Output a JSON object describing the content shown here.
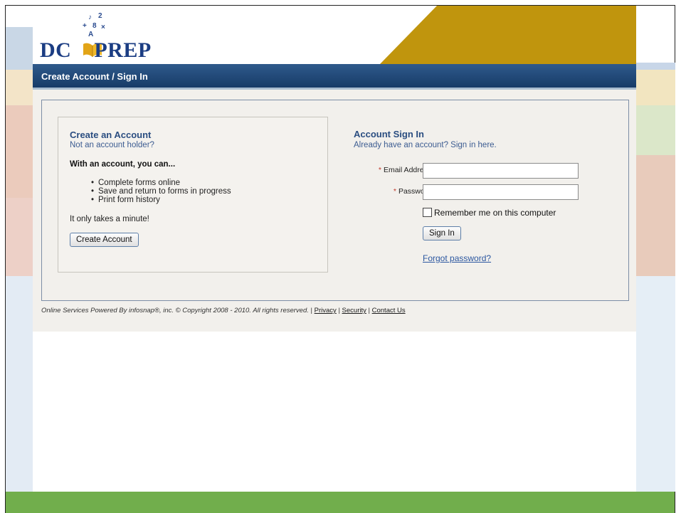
{
  "header": {
    "logo_text_left": "DC",
    "logo_text_right": "PREP",
    "logo_glyphs": [
      "♪",
      "2",
      "8",
      "A",
      "+",
      "×"
    ]
  },
  "titlebar": {
    "title": "Create Account / Sign In"
  },
  "create_account": {
    "heading": "Create an Account",
    "subheading": "Not an account holder?",
    "lead": "With an account, you can...",
    "benefits": [
      "Complete forms online",
      "Save and return to forms in progress",
      "Print form history"
    ],
    "note": "It only takes a minute!",
    "button_label": "Create Account"
  },
  "sign_in": {
    "heading": "Account Sign In",
    "subheading": "Already have an account? Sign in here.",
    "email_label": "Email Address:",
    "email_value": "",
    "password_label": "Password:",
    "password_value": "",
    "required_marker": "*",
    "remember_label": "Remember me on this computer",
    "remember_checked": false,
    "button_label": "Sign In",
    "forgot_label": "Forgot password?"
  },
  "footer": {
    "text": "Online Services Powered By infosnap®, inc. © Copyright 2008 - 2010. All rights reserved.",
    "links": [
      "Privacy",
      "Security",
      "Contact Us"
    ],
    "separator": "|"
  },
  "colors": {
    "brand_blue": "#1b3d83",
    "gold": "#c0950d",
    "titlebar": "#173b67",
    "bottom_bar": "#71ae4c"
  }
}
